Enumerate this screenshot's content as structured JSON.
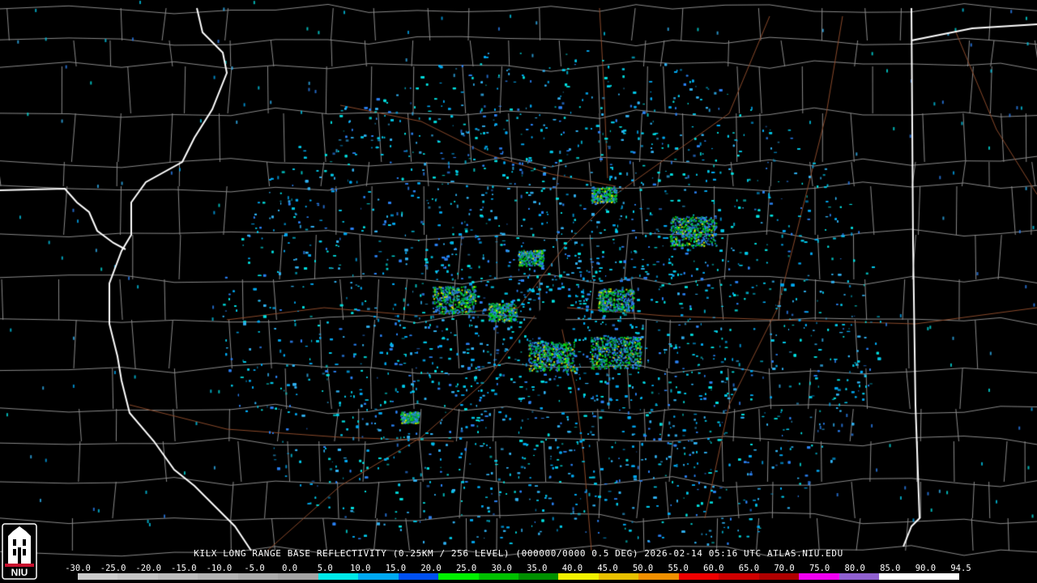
{
  "map": {
    "caption": "KILX LONG RANGE BASE REFLECTIVITY (0.25KM / 256 LEVEL) (000000/0000 0.5 DEG) 2026-02-14 05:16 UTC  ATLAS.NIU.EDU",
    "colors": {
      "background": "#000000",
      "county_lines": "#8a8a8a",
      "state_lines": "#ffffff",
      "highways": "#8b4a2b"
    }
  },
  "logo": {
    "text": "NIU",
    "icon": "niu-tower-logo-icon",
    "colors": {
      "border": "#c8102e",
      "fill": "#ffffff"
    }
  },
  "scale": {
    "labels": [
      "-30.0",
      "-25.0",
      "-20.0",
      "-15.0",
      "-10.0",
      "-5.0",
      "0.0",
      "5.0",
      "10.0",
      "15.0",
      "20.0",
      "25.0",
      "30.0",
      "35.0",
      "40.0",
      "45.0",
      "50.0",
      "55.0",
      "60.0",
      "65.0",
      "70.0",
      "75.0",
      "80.0",
      "85.0",
      "90.0",
      "94.5"
    ],
    "colors": [
      "#cccccc",
      "#c4c4c4",
      "#bcbcbc",
      "#b4b4b4",
      "#acacac",
      "#a4a4a4",
      "#00e8e8",
      "#00a8f0",
      "#0050f0",
      "#00f000",
      "#00c000",
      "#009000",
      "#f0f000",
      "#e8c000",
      "#f09000",
      "#f00000",
      "#d00000",
      "#b00000",
      "#f000f0",
      "#9060d0",
      "#ffffff",
      "#ffffff"
    ]
  }
}
